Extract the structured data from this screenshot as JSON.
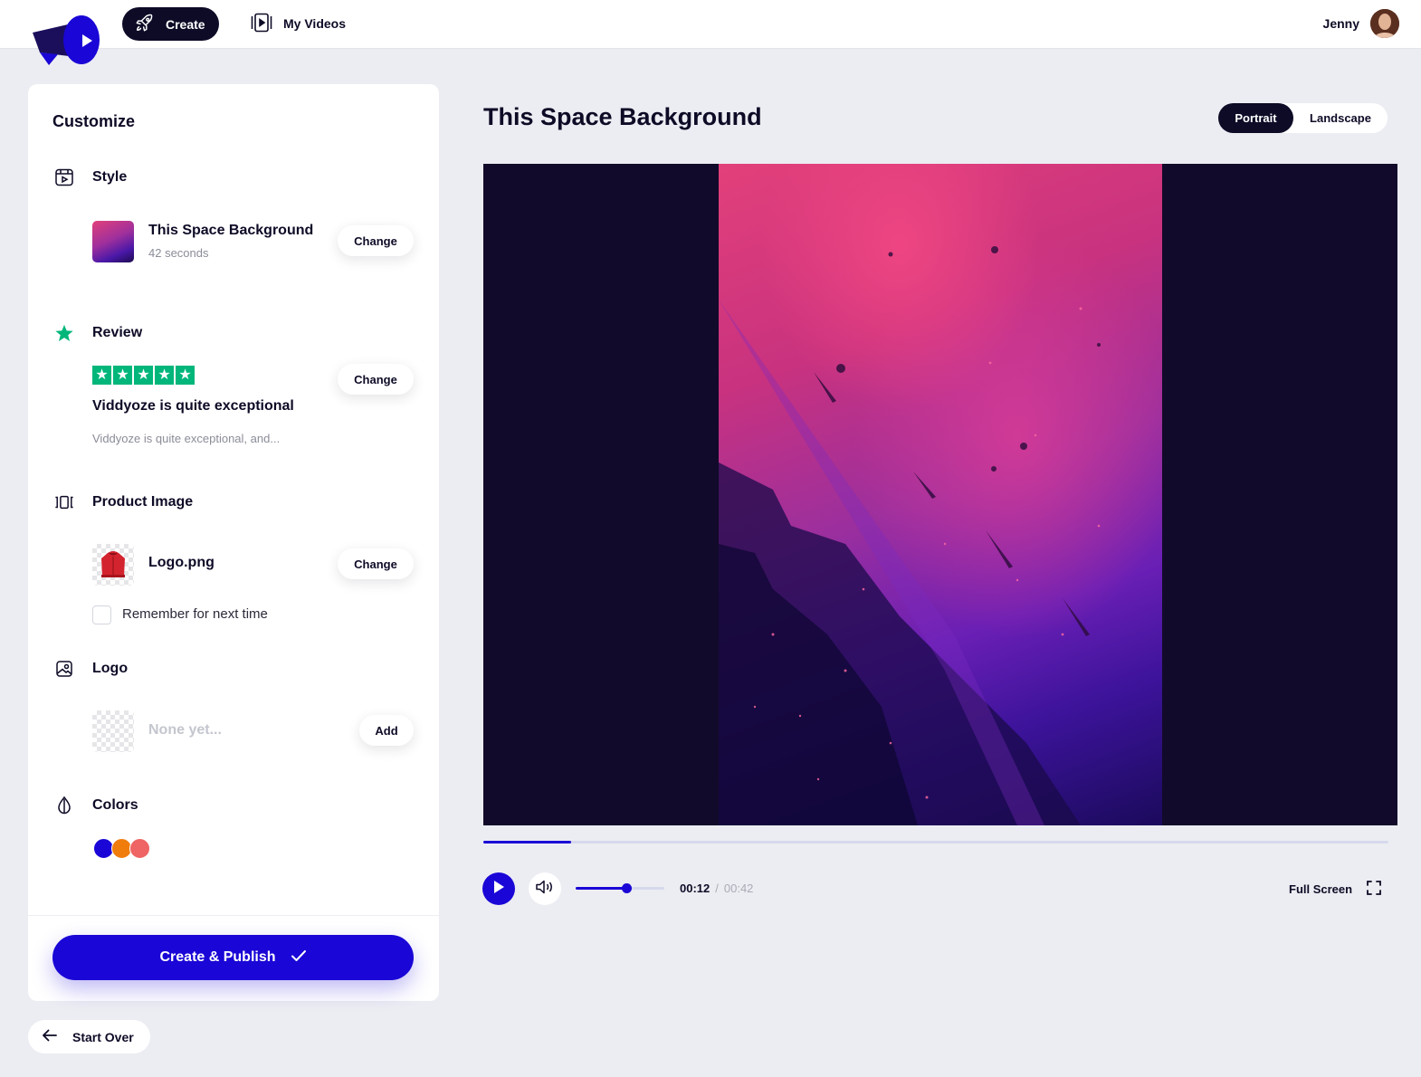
{
  "nav": {
    "create_label": "Create",
    "myvideos_label": "My Videos",
    "user_name": "Jenny"
  },
  "panel": {
    "title": "Customize",
    "style": {
      "heading": "Style",
      "name": "This Space Background",
      "duration": "42 seconds",
      "button": "Change"
    },
    "review": {
      "heading": "Review",
      "stars": 5,
      "title": "Viddyoze is quite exceptional",
      "excerpt": "Viddyoze is quite exceptional, and...",
      "button": "Change"
    },
    "product_image": {
      "heading": "Product Image",
      "file": "Logo.png",
      "button": "Change",
      "remember_label": "Remember for next time",
      "remember_checked": false
    },
    "logo": {
      "heading": "Logo",
      "placeholder": "None yet...",
      "button": "Add"
    },
    "colors": {
      "heading": "Colors",
      "swatches": [
        "#1a06d6",
        "#f07c0c",
        "#ef6464"
      ]
    },
    "publish_label": "Create & Publish",
    "start_over_label": "Start Over"
  },
  "preview": {
    "title": "This Space Background",
    "orientation_options": [
      "Portrait",
      "Landscape"
    ],
    "selected_orientation": "Portrait",
    "progress_fraction": 0.097,
    "volume_fraction": 0.57,
    "current_time": "00:12",
    "separator": "/",
    "total_time": "00:42",
    "fullscreen_label": "Full Screen"
  },
  "colors": {
    "accent": "#1a06d6",
    "dark": "#0d0b26",
    "trustpilot_green": "#00b67a"
  },
  "icons": [
    "rocket-icon",
    "video-library-icon",
    "style-icon",
    "star-icon",
    "product-image-icon",
    "logo-image-icon",
    "drop-icon",
    "check-icon",
    "arrow-left-icon",
    "play-icon",
    "speaker-icon",
    "fullscreen-icon"
  ]
}
